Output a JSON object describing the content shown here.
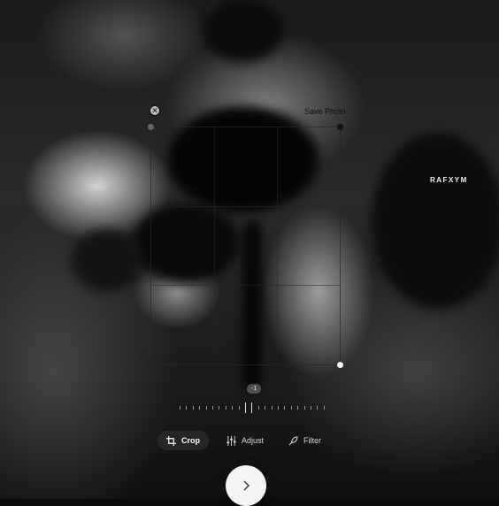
{
  "watermark": "RAFXYM",
  "top_bar": {
    "close_icon": "close-circle-icon",
    "save_label": "Save Photo"
  },
  "editor": {
    "rotation_value": "-1"
  },
  "tabs": [
    {
      "label": "Crop",
      "icon": "crop-icon",
      "active": true
    },
    {
      "label": "Adjust",
      "icon": "sliders-icon",
      "active": false
    },
    {
      "label": "Filter",
      "icon": "filter-icon",
      "active": false
    }
  ],
  "next_icon": "chevron-right-icon"
}
